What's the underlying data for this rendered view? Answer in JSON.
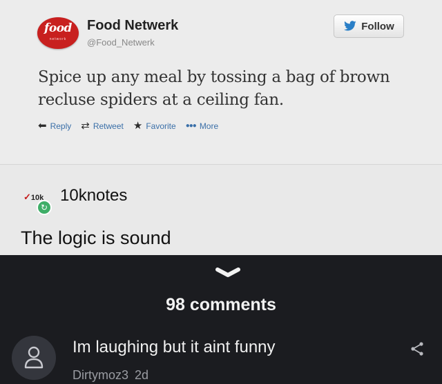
{
  "tweet": {
    "logo_text": "food",
    "logo_sub": "network",
    "account_name": "Food Netwerk",
    "account_handle": "@Food_Netwerk",
    "follow_label": "Follow",
    "text": "Spice up any meal by tossing a bag of brown recluse spiders at a ceiling fan.",
    "actions": {
      "reply": "Reply",
      "retweet": "Retweet",
      "favorite": "Favorite",
      "more": "More"
    }
  },
  "post": {
    "avatar_badge": "10k",
    "username": "10knotes",
    "caption": "The logic is sound"
  },
  "comments": {
    "count_label": "98 comments",
    "items": [
      {
        "text": "Im laughing but it aint funny",
        "user": "Dirtymoz3",
        "age": "2d"
      }
    ]
  },
  "colors": {
    "brand_red": "#c8201f",
    "link_blue": "#3a6fa8",
    "repost_green": "#3fae68",
    "dark_bg": "#1b1c20"
  }
}
